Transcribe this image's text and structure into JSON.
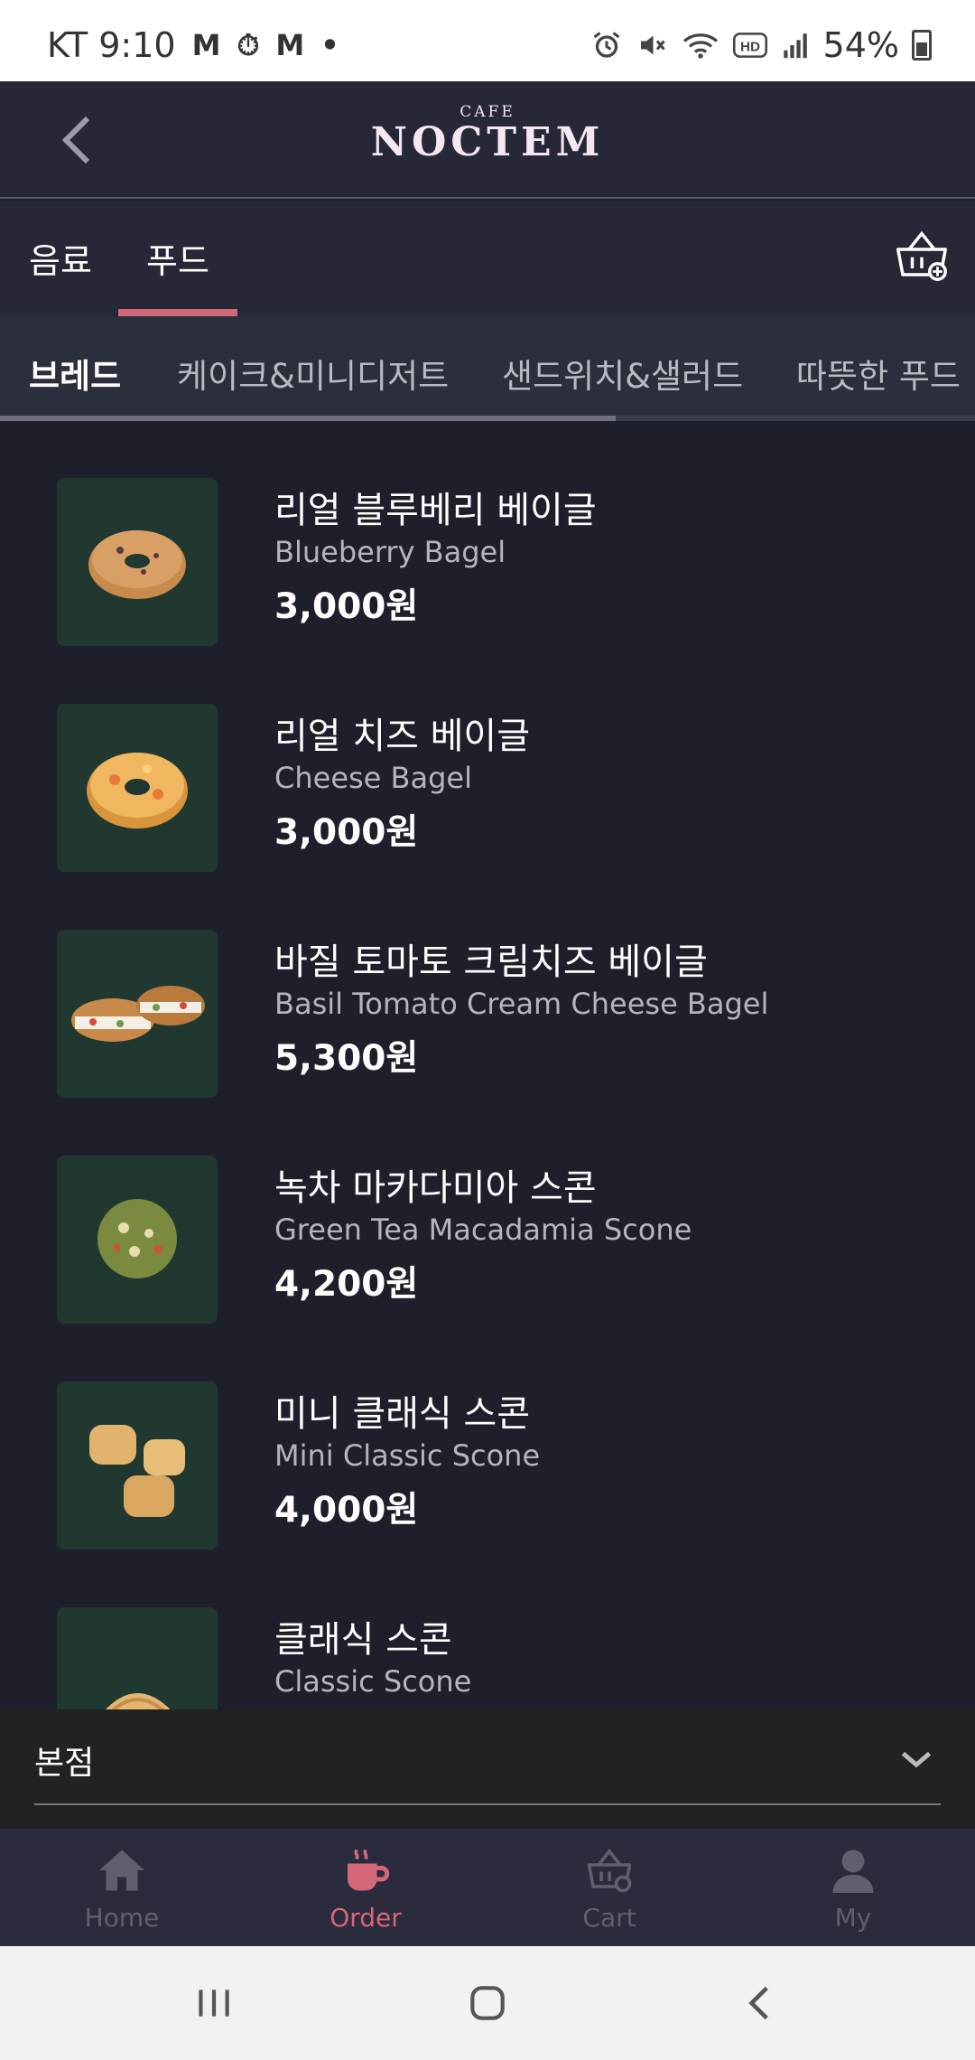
{
  "status_bar": {
    "carrier_time": "KT 9:10",
    "notif_icons": [
      "M",
      "⏱",
      "M",
      "•"
    ],
    "battery": "54%"
  },
  "header": {
    "logo_small": "CAFE",
    "logo_big": "NOCTEM",
    "back_icon": "chevron-left-icon"
  },
  "top_tabs": [
    {
      "label": "음료",
      "active": false
    },
    {
      "label": "푸드",
      "active": true
    }
  ],
  "sub_tabs": [
    {
      "label": "브레드",
      "active": true
    },
    {
      "label": "케이크&미니디저트",
      "active": false
    },
    {
      "label": "샌드위치&샐러드",
      "active": false
    },
    {
      "label": "따뜻한 푸드",
      "active": false
    }
  ],
  "items": [
    {
      "name_ko": "리얼 블루베리 베이글",
      "name_en": "Blueberry Bagel",
      "price": "3,000원"
    },
    {
      "name_ko": "리얼 치즈 베이글",
      "name_en": "Cheese Bagel",
      "price": "3,000원"
    },
    {
      "name_ko": "바질 토마토 크림치즈 베이글",
      "name_en": "Basil Tomato Cream Cheese Bagel",
      "price": "5,300원"
    },
    {
      "name_ko": "녹차 마카다미아 스콘",
      "name_en": "Green Tea Macadamia Scone",
      "price": "4,200원"
    },
    {
      "name_ko": "미니 클래식 스콘",
      "name_en": "Mini Classic Scone",
      "price": "4,000원"
    },
    {
      "name_ko": "클래식 스콘",
      "name_en": "Classic Scone",
      "price": ""
    }
  ],
  "store_selector": {
    "label": "본점"
  },
  "bottom_nav": [
    {
      "label": "Home",
      "active": false
    },
    {
      "label": "Order",
      "active": true
    },
    {
      "label": "Cart",
      "active": false
    },
    {
      "label": "My",
      "active": false
    }
  ],
  "colors": {
    "accent": "#d4677a",
    "background": "#1d1f2b",
    "header": "#262838",
    "thumb_bg": "#20382f"
  }
}
